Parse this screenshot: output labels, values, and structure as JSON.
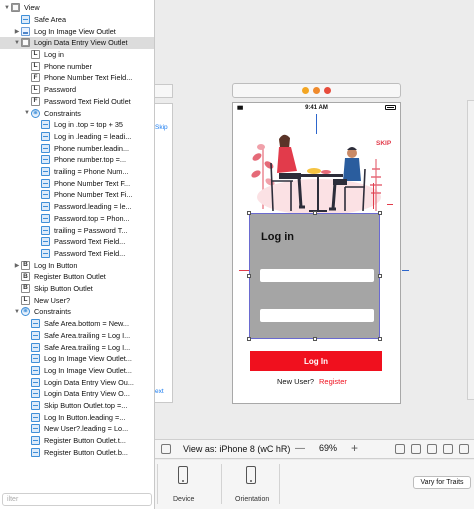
{
  "outline": {
    "items": [
      {
        "label": "View",
        "icon": "view",
        "disc": "▼",
        "indent": 0
      },
      {
        "label": "Safe Area",
        "icon": "lay",
        "disc": "",
        "indent": 1
      },
      {
        "label": "Log In Image View Outlet",
        "icon": "img",
        "disc": "▶",
        "indent": 1
      },
      {
        "label": "Login Data Entry View Outlet",
        "icon": "view",
        "disc": "▼",
        "indent": 1,
        "selected": true
      },
      {
        "label": "Log in",
        "icon": "L",
        "disc": "",
        "indent": 2
      },
      {
        "label": "Phone number",
        "icon": "L",
        "disc": "",
        "indent": 2
      },
      {
        "label": "Phone Number Text Field...",
        "icon": "F",
        "disc": "",
        "indent": 2
      },
      {
        "label": "Password",
        "icon": "L",
        "disc": "",
        "indent": 2
      },
      {
        "label": "Password Text Field Outlet",
        "icon": "F",
        "disc": "",
        "indent": 2
      },
      {
        "label": "Constraints",
        "icon": "cons",
        "disc": "▼",
        "indent": 2
      },
      {
        "label": "Log in .top = top + 35",
        "icon": "lay",
        "disc": "",
        "indent": 3
      },
      {
        "label": "Log in .leading = leadi...",
        "icon": "lay",
        "disc": "",
        "indent": 3
      },
      {
        "label": "Phone number.leadin...",
        "icon": "lay",
        "disc": "",
        "indent": 3
      },
      {
        "label": "Phone number.top =...",
        "icon": "lay",
        "disc": "",
        "indent": 3
      },
      {
        "label": "trailing = Phone Num...",
        "icon": "lay",
        "disc": "",
        "indent": 3
      },
      {
        "label": "Phone Number Text F...",
        "icon": "lay",
        "disc": "",
        "indent": 3
      },
      {
        "label": "Phone Number Text Fi...",
        "icon": "lay",
        "disc": "",
        "indent": 3
      },
      {
        "label": "Password.leading = le...",
        "icon": "lay",
        "disc": "",
        "indent": 3
      },
      {
        "label": "Password.top = Phon...",
        "icon": "lay",
        "disc": "",
        "indent": 3
      },
      {
        "label": "trailing = Password T...",
        "icon": "lay",
        "disc": "",
        "indent": 3
      },
      {
        "label": "Password Text Field...",
        "icon": "lay",
        "disc": "",
        "indent": 3
      },
      {
        "label": "Password Text Field...",
        "icon": "lay",
        "disc": "",
        "indent": 3
      },
      {
        "label": "Log In Button",
        "icon": "B",
        "disc": "▶",
        "indent": 1
      },
      {
        "label": "Register Button Outlet",
        "icon": "B",
        "disc": "",
        "indent": 1
      },
      {
        "label": "Skip Button Outlet",
        "icon": "B",
        "disc": "",
        "indent": 1
      },
      {
        "label": "New User?",
        "icon": "L",
        "disc": "",
        "indent": 1
      },
      {
        "label": "Constraints",
        "icon": "cons",
        "disc": "▼",
        "indent": 1
      },
      {
        "label": "Safe Area.bottom = New...",
        "icon": "lay",
        "disc": "",
        "indent": 2
      },
      {
        "label": "Safe Area.trailing = Log I...",
        "icon": "lay",
        "disc": "",
        "indent": 2
      },
      {
        "label": "Safe Area.trailing = Log I...",
        "icon": "lay",
        "disc": "",
        "indent": 2
      },
      {
        "label": "Log In Image View Outlet...",
        "icon": "lay",
        "disc": "",
        "indent": 2
      },
      {
        "label": "Log In Image View Outlet...",
        "icon": "lay",
        "disc": "",
        "indent": 2
      },
      {
        "label": "Login Data Entry View Ou...",
        "icon": "lay",
        "disc": "",
        "indent": 2
      },
      {
        "label": "Login Data Entry View O...",
        "icon": "lay",
        "disc": "",
        "indent": 2
      },
      {
        "label": "Skip Button Outlet.top =...",
        "icon": "lay",
        "disc": "",
        "indent": 2
      },
      {
        "label": "Log In Button.leading =...",
        "icon": "lay",
        "disc": "",
        "indent": 2
      },
      {
        "label": "New User?.leading = Lo...",
        "icon": "lay",
        "disc": "",
        "indent": 2
      },
      {
        "label": "Register Button Outlet.t...",
        "icon": "lay",
        "disc": "",
        "indent": 2
      },
      {
        "label": "Register Button Outlet.b...",
        "icon": "lay",
        "disc": "",
        "indent": 2
      }
    ],
    "filter_placeholder": "ilter"
  },
  "scene": {
    "status_time": "9:41 AM",
    "skip": "SKIP",
    "login_title": "Log in",
    "login_button": "Log In",
    "new_user": "New User?",
    "register": "Register",
    "prev_skip": "Skip",
    "prev_text": "ext"
  },
  "footer": {
    "view_as": "View as: iPhone 8 (wC hR)",
    "zoom": "69%",
    "zoom_out": "—",
    "zoom_in": "+"
  },
  "device_bar": {
    "device_label": "Device",
    "orientation_label": "Orientation",
    "vary_button": "Vary for Traits"
  },
  "colors": {
    "accent": "#f0101e",
    "selection": "#dcdcdc",
    "login_box": "#a5a5a5"
  }
}
